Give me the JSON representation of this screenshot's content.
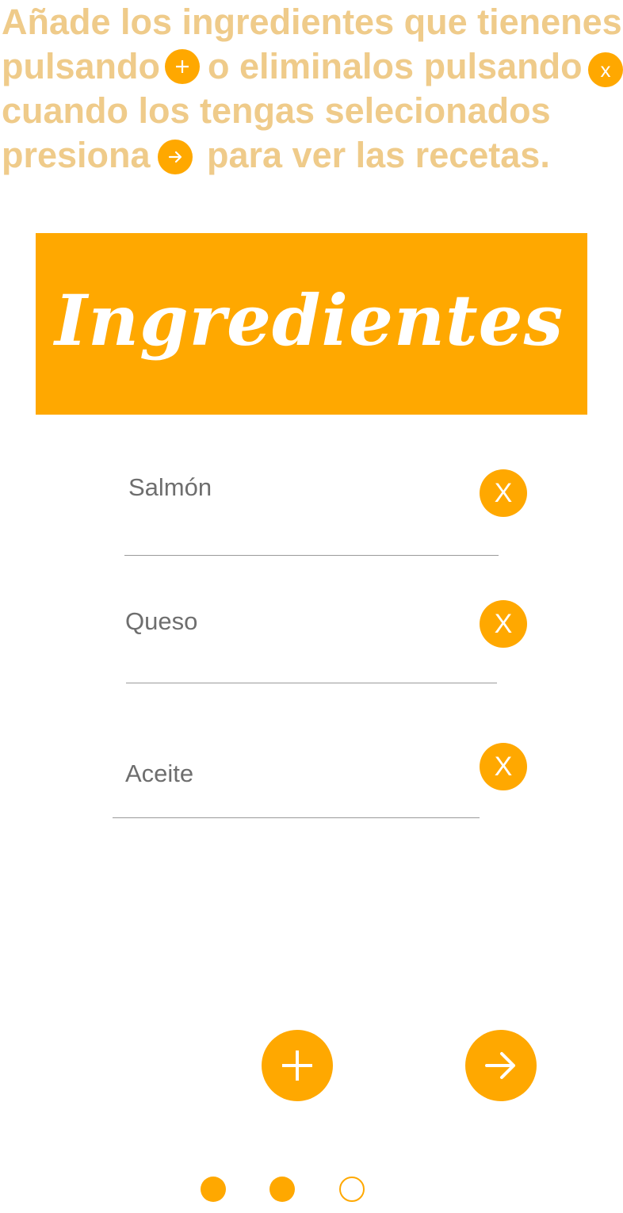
{
  "instructions": {
    "line1": "Añade los ingredientes que tienenes",
    "line2_a": "pulsando",
    "line2_b": "o eliminalos pulsando",
    "line3": "cuando los tengas selecionados",
    "line4_a": "presiona",
    "line4_b": "para ver las recetas.",
    "remove_glyph": "x"
  },
  "banner": {
    "title": "Ingredientes"
  },
  "ingredients": [
    {
      "name": "Salmón",
      "remove_label": "X"
    },
    {
      "name": "Queso",
      "remove_label": "X"
    },
    {
      "name": "Aceite",
      "remove_label": "X"
    }
  ],
  "actions": {
    "add_icon": "plus-icon",
    "next_icon": "arrow-right-icon"
  },
  "pagination": {
    "pages": 3,
    "current": 2
  },
  "colors": {
    "accent": "#FFA800",
    "instruction_text": "#EFCB8A",
    "ingredient_text": "#6E6E6E"
  }
}
